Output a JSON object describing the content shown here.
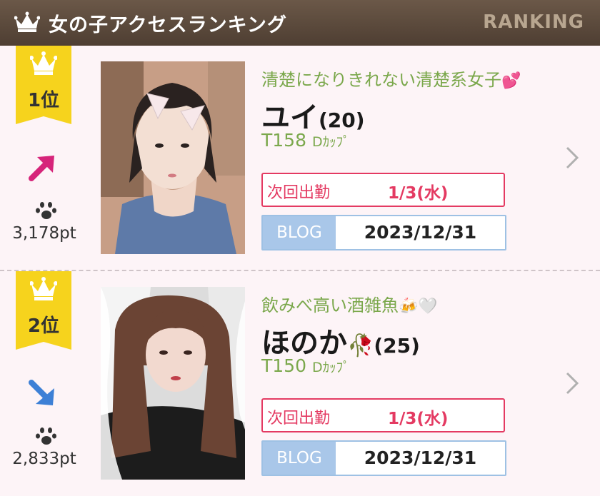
{
  "header": {
    "title": "女の子アクセスランキング",
    "label": "RANKING",
    "icon": "crown-icon"
  },
  "accent": {
    "rank_badge": "#f6d31d",
    "green_text": "#7ba84c",
    "work_red": "#e43a62",
    "blog_blue": "#a9c7e9"
  },
  "entries": [
    {
      "rank": "1位",
      "trend": "up",
      "trend_icon": "arrow-up-right-icon",
      "points": "3,178pt",
      "catchphrase": "清楚になりきれない清楚系女子",
      "catch_emoji": "💕",
      "name": "ユイ",
      "name_emoji": "",
      "age": "(20)",
      "height": "T158",
      "cup_label": "Dｶｯﾌﾟ",
      "work_label": "次回出勤",
      "work_date": "1/3(水)",
      "blog_label": "BLOG",
      "blog_date": "2023/12/31"
    },
    {
      "rank": "2位",
      "trend": "down",
      "trend_icon": "arrow-down-right-icon",
      "points": "2,833pt",
      "catchphrase": "飲みべ高い酒雑魚",
      "catch_emoji": "🍻🤍",
      "name": "ほのか",
      "name_emoji": "🥀",
      "age": "(25)",
      "height": "T150",
      "cup_label": "Dｶｯﾌﾟ",
      "work_label": "次回出勤",
      "work_date": "1/3(水)",
      "blog_label": "BLOG",
      "blog_date": "2023/12/31"
    }
  ]
}
